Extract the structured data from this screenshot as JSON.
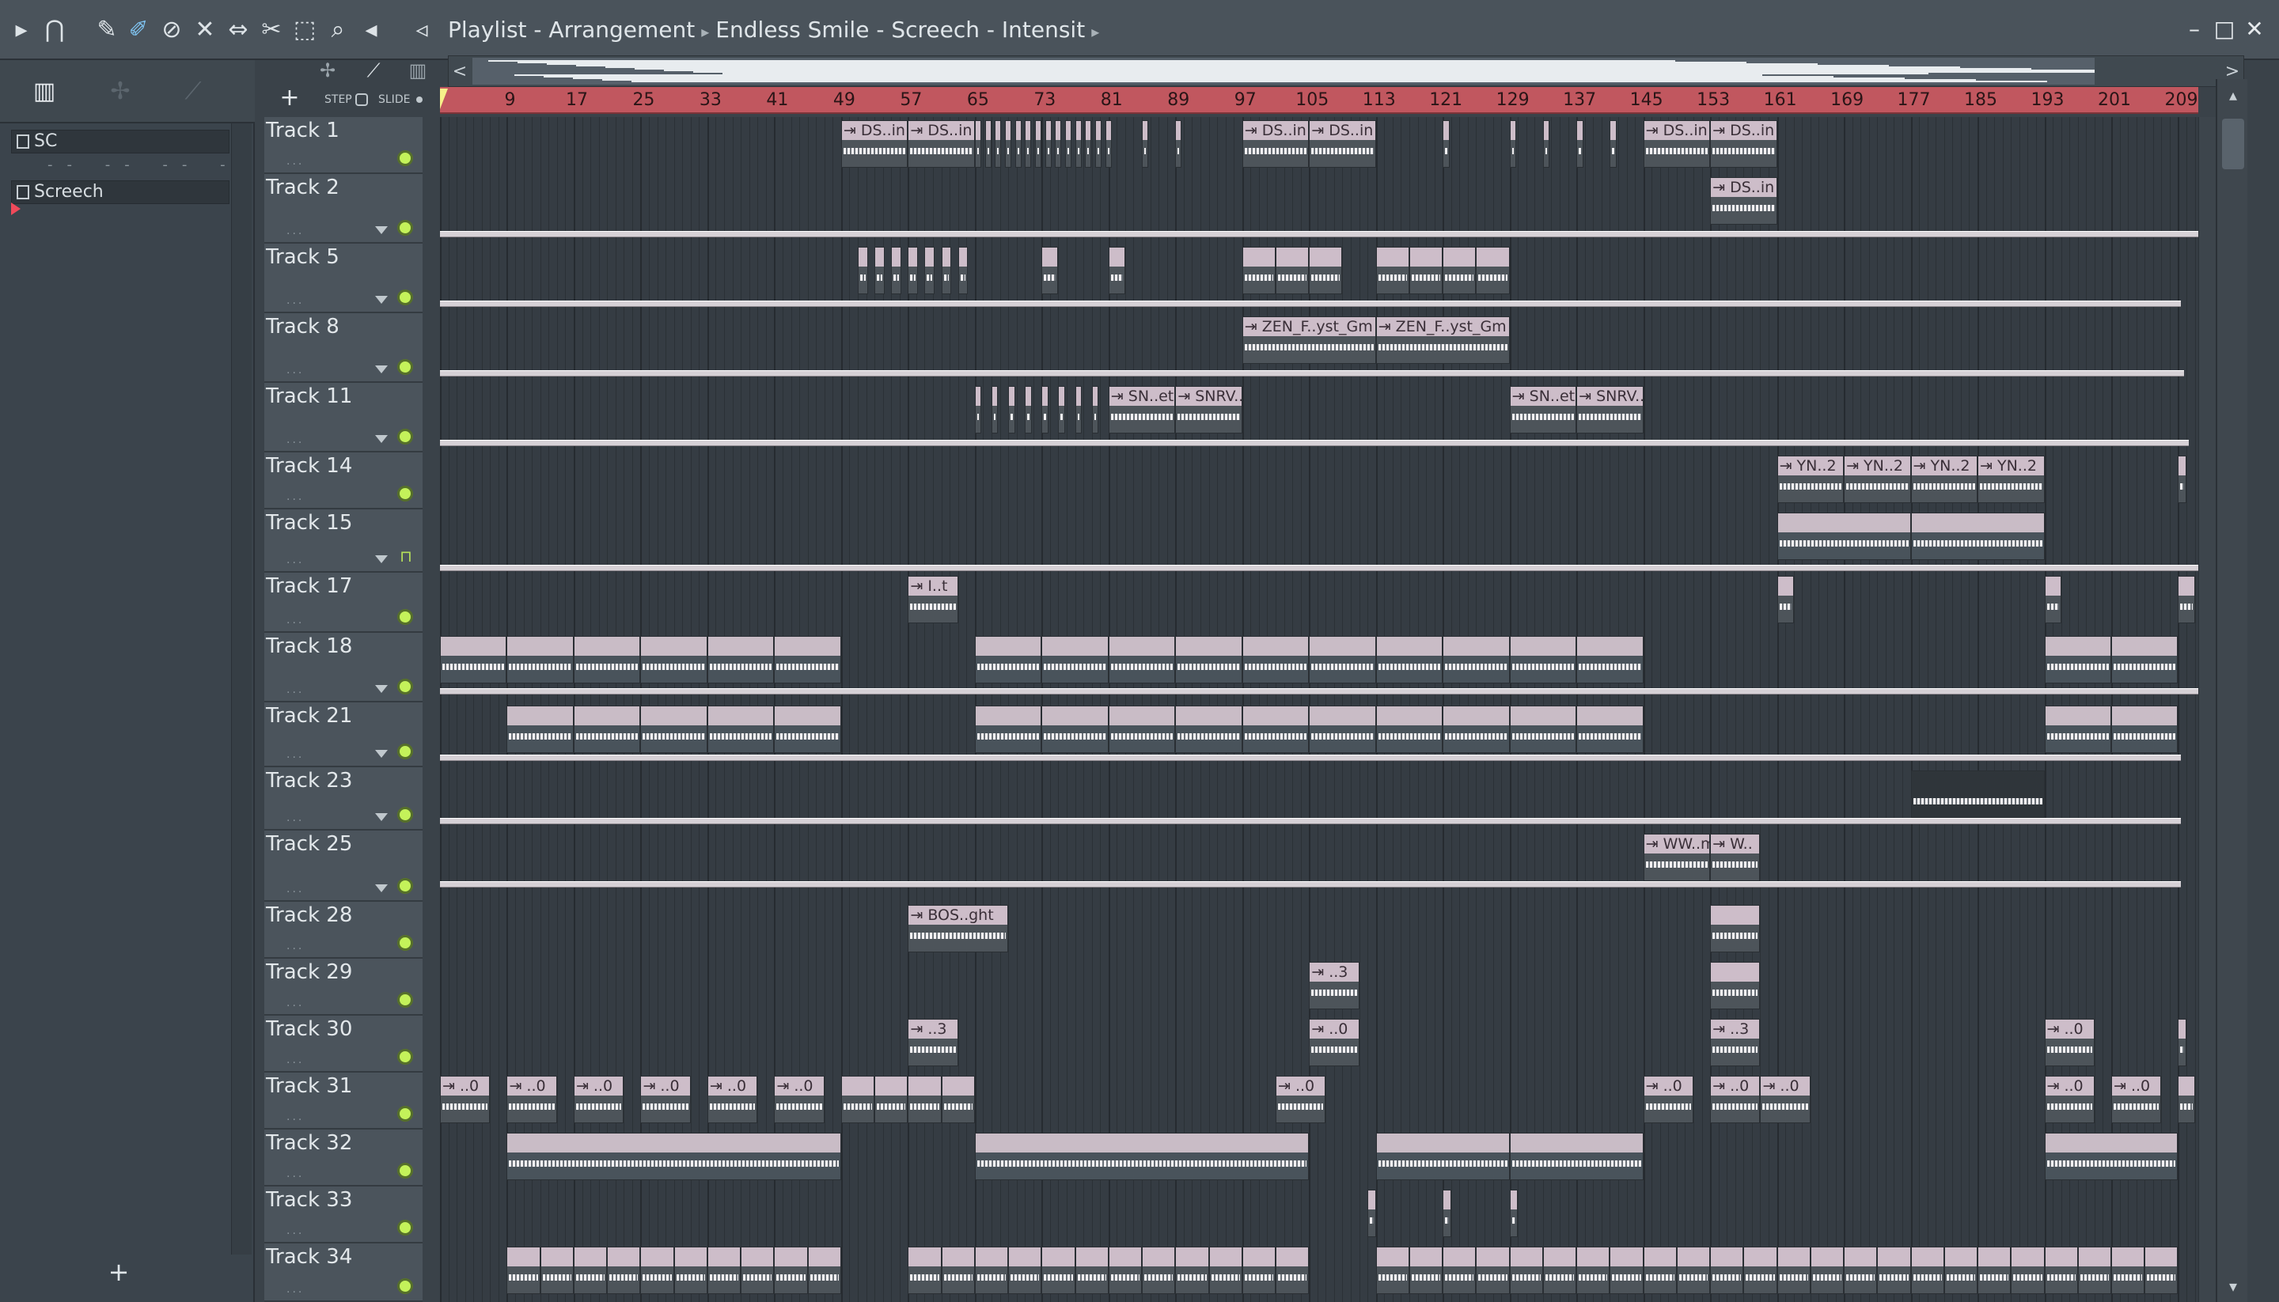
{
  "titlebar": {
    "title_parts": [
      "Playlist - Arrangement",
      "Endless Smile - Screech - Intensit"
    ],
    "window_controls": [
      "minimize",
      "maximize",
      "close"
    ],
    "tool_icons": [
      "arrow-icon",
      "magnet-icon",
      "pencil-icon",
      "brush-icon",
      "mute-slash-icon",
      "speaker-mute-icon",
      "slip-icon",
      "slice-icon",
      "select-icon",
      "zoom-icon",
      "playback-icon",
      "speaker-icon"
    ]
  },
  "left_panel": {
    "patterns": [
      {
        "label": "SC"
      },
      {
        "label": "Screech"
      }
    ],
    "add_label": "+"
  },
  "playlist_toolbar": {
    "add_track": "+",
    "step_label": "STEP",
    "slide_label": "SLIDE"
  },
  "ruler": {
    "bars": [
      "9",
      "17",
      "25",
      "33",
      "41",
      "49",
      "57",
      "65",
      "73",
      "81",
      "89",
      "97",
      "105",
      "113",
      "121",
      "129",
      "137",
      "145",
      "153",
      "161",
      "169",
      "177",
      "185",
      "193",
      "201",
      "209"
    ]
  },
  "tracks": [
    {
      "name": "Track 1",
      "dots": "...",
      "locked": false,
      "arrow": false
    },
    {
      "name": "Track 2",
      "dots": "...",
      "locked": false,
      "arrow": true
    },
    {
      "name": "Track 5",
      "dots": "...",
      "locked": false,
      "arrow": true
    },
    {
      "name": "Track 8",
      "dots": "...",
      "locked": false,
      "arrow": true
    },
    {
      "name": "Track 11",
      "dots": "...",
      "locked": false,
      "arrow": true
    },
    {
      "name": "Track 14",
      "dots": "...",
      "locked": false,
      "arrow": false
    },
    {
      "name": "Track 15",
      "dots": "...",
      "locked": true,
      "arrow": true
    },
    {
      "name": "Track 17",
      "dots": "...",
      "locked": false,
      "arrow": false
    },
    {
      "name": "Track 18",
      "dots": "...",
      "locked": false,
      "arrow": true
    },
    {
      "name": "Track 21",
      "dots": "...",
      "locked": false,
      "arrow": true
    },
    {
      "name": "Track 23",
      "dots": "...",
      "locked": false,
      "arrow": true
    },
    {
      "name": "Track 25",
      "dots": "...",
      "locked": false,
      "arrow": true
    },
    {
      "name": "Track 28",
      "dots": "...",
      "locked": false,
      "arrow": false
    },
    {
      "name": "Track 29",
      "dots": "...",
      "locked": false,
      "arrow": false
    },
    {
      "name": "Track 30",
      "dots": "...",
      "locked": false,
      "arrow": false
    },
    {
      "name": "Track 31",
      "dots": "...",
      "locked": false,
      "arrow": false
    },
    {
      "name": "Track 32",
      "dots": "...",
      "locked": false,
      "arrow": false
    },
    {
      "name": "Track 33",
      "dots": "...",
      "locked": false,
      "arrow": false
    },
    {
      "name": "Track 34",
      "dots": "...",
      "locked": false,
      "arrow": false
    }
  ],
  "clip_labels": {
    "ds_in": "DS..in",
    "zen": "ZEN_F..yst_Gm",
    "sn_et": "SN..et",
    "snrv": "SNRV.._Wet",
    "yn2": "YN..2",
    "it": "I..t",
    "ww_m": "WW..m",
    "w": "W..",
    "bos": "BOS..ght",
    "dot3": "..3",
    "dot0": "..0"
  },
  "colors": {
    "ruler": "#c1575f",
    "clip_header": "#cdbdc9",
    "led_on": "#c4f25a",
    "background": "#353c43"
  }
}
